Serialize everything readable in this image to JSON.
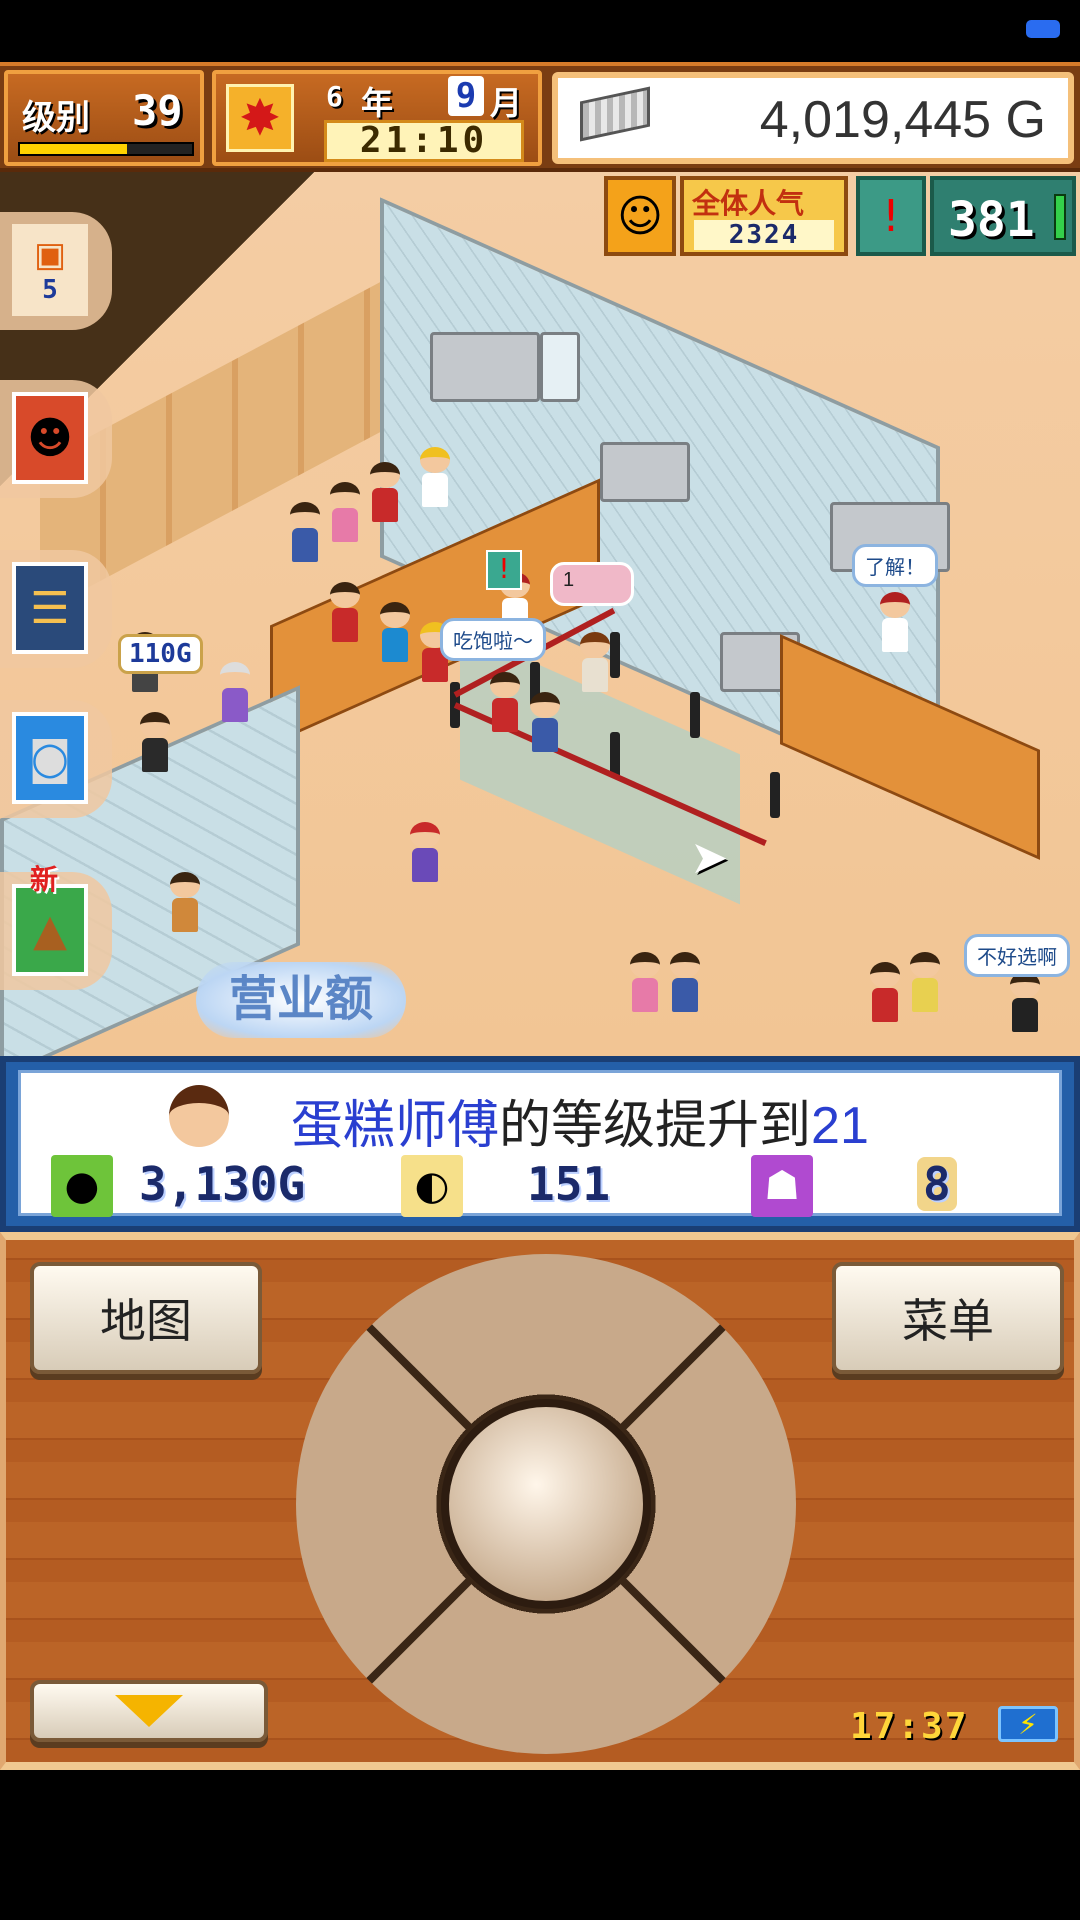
{
  "hud": {
    "level_label": "级别",
    "level_value": "39",
    "level_progress": 0.62,
    "year_value": "6",
    "year_label": "年",
    "month_value": "9",
    "month_label": "月",
    "clock": "21:10",
    "money": "4,019,445",
    "money_unit": "G",
    "popularity_label": "全体人气",
    "popularity_value": "2324",
    "alert_value": "381"
  },
  "side_menu": {
    "shop_count": "5",
    "new_badge": "新"
  },
  "world": {
    "coin_tip": "110G",
    "bubble_ok": "了解！",
    "bubble_full": "吃饱啦～",
    "bubble_hard": "不好选啊",
    "bubble_count": "1",
    "sales_label": "营业额"
  },
  "message": {
    "name": "蛋糕师傅",
    "middle": "的等级提升到",
    "level": "21",
    "money_gain": "3,130G",
    "spoon_gain": "151",
    "ghost_gain": "8"
  },
  "controller": {
    "map_label": "地图",
    "menu_label": "菜单",
    "game_clock": "17:37"
  },
  "colors": {
    "hud_bg": "#7a3d12",
    "message_bg": "#245fa8",
    "wood": "#b45c22",
    "name_highlight": "#2a3fd0"
  }
}
